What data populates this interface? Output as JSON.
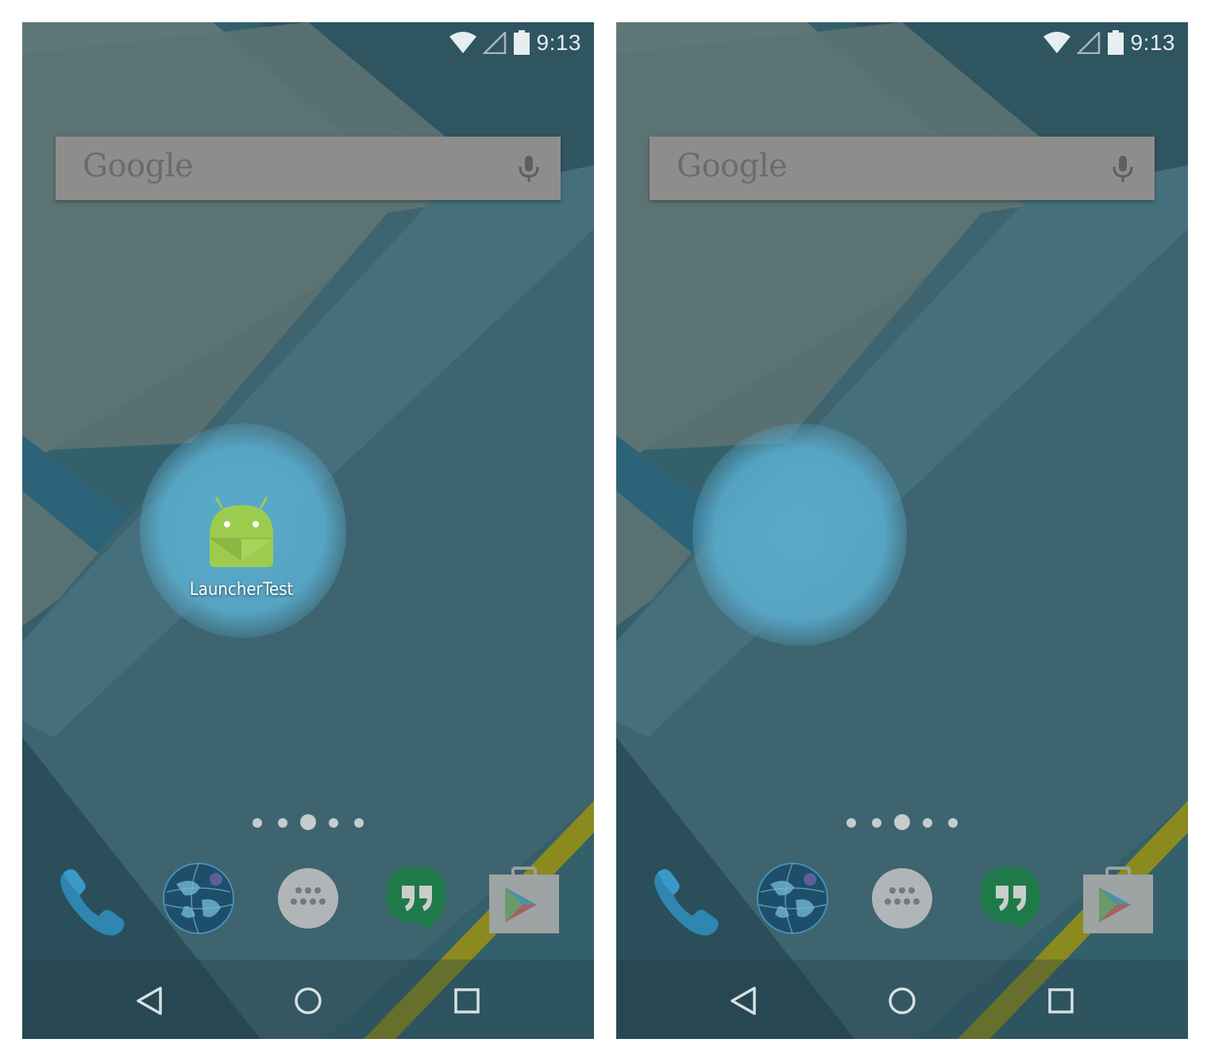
{
  "screens": [
    {
      "id": "before",
      "status_bar": {
        "time": "9:13",
        "icons": [
          "wifi-icon",
          "cell-signal-icon",
          "battery-icon"
        ]
      },
      "search_widget": {
        "logo_text": "Google",
        "mic_icon": "mic-icon"
      },
      "app_shortcut": {
        "label": "LauncherTest",
        "icon": "android-app-icon"
      },
      "page_indicator": {
        "count": 5,
        "active_index": 2
      },
      "dock": [
        "phone-icon",
        "browser-globe-icon",
        "app-drawer-icon",
        "hangouts-icon",
        "play-store-icon"
      ],
      "nav_bar": [
        "back-icon",
        "home-icon",
        "recents-icon"
      ]
    },
    {
      "id": "after",
      "status_bar": {
        "time": "9:13",
        "icons": [
          "wifi-icon",
          "cell-signal-icon",
          "battery-icon"
        ]
      },
      "search_widget": {
        "logo_text": "Google",
        "mic_icon": "mic-icon"
      },
      "page_indicator": {
        "count": 5,
        "active_index": 2
      },
      "dock": [
        "phone-icon",
        "browser-globe-icon",
        "app-drawer-icon",
        "hangouts-icon",
        "play-store-icon"
      ],
      "nav_bar": [
        "back-icon",
        "home-icon",
        "recents-icon"
      ]
    }
  ],
  "colors": {
    "wallpaper_dark": "#2f5561",
    "wallpaper_mid": "#3e6470",
    "wallpaper_light": "#5c7272",
    "wallpaper_blue": "#466f7e",
    "accent_yellow": "#8a8a1e",
    "search_bar": "#8f8d8b",
    "glow": "#5aaed0",
    "android_green": "#9ccc4e"
  }
}
